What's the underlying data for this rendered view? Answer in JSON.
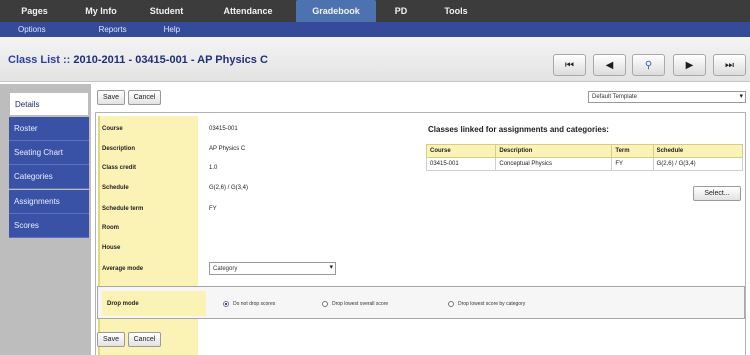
{
  "topnav": {
    "tabs": [
      {
        "label": "Pages"
      },
      {
        "label": "My Info"
      },
      {
        "label": "Student"
      },
      {
        "label": "Attendance"
      },
      {
        "label": "Gradebook",
        "active": true
      },
      {
        "label": "PD"
      },
      {
        "label": "Tools"
      }
    ]
  },
  "subnav": {
    "items": [
      "Options",
      "Reports",
      "Help"
    ]
  },
  "titlebar": {
    "label": "Class List ::",
    "class_title": "2010-2011 - 03415-001 - AP Physics C",
    "nav": {
      "first_icon": "first-page-icon",
      "prev_icon": "previous-icon",
      "search_icon": "search-icon",
      "next_icon": "next-icon",
      "last_icon": "last-page-icon"
    }
  },
  "sidebar": {
    "items": [
      {
        "label": "Details",
        "active": true
      },
      {
        "label": "Roster"
      },
      {
        "label": "Seating Chart"
      },
      {
        "label": "Categories"
      },
      {
        "label": "Assignments"
      },
      {
        "label": "Scores"
      }
    ]
  },
  "toolbar": {
    "save_label": "Save",
    "cancel_label": "Cancel",
    "template_select": "Default Template"
  },
  "details": {
    "fields": [
      {
        "label": "Course",
        "value": "03415-001"
      },
      {
        "label": "Description",
        "value": "AP Physics C"
      },
      {
        "label": "Class credit",
        "value": "1.0"
      },
      {
        "label": "Schedule",
        "value": "G(2,6) / G(3,4)"
      },
      {
        "label": "Schedule term",
        "value": "FY"
      },
      {
        "label": "Room",
        "value": ""
      },
      {
        "label": "House",
        "value": ""
      },
      {
        "label": "Average mode",
        "value": "Category"
      }
    ]
  },
  "classes": {
    "title": "Classes linked for assignments and categories:",
    "headers": [
      "Course",
      "Description",
      "Term",
      "Schedule"
    ],
    "rows": [
      [
        "03415-001",
        "Conceptual Physics",
        "FY",
        "G(2,6) / G(3,4)"
      ]
    ],
    "button_label": "Select..."
  },
  "drop_mode": {
    "label": "Drop mode",
    "options": [
      {
        "label": "Do not drop scores",
        "selected": true
      },
      {
        "label": "Drop lowest overall score",
        "selected": false
      },
      {
        "label": "Drop lowest score by category",
        "selected": false
      }
    ]
  },
  "bottom": {
    "save_label": "Save",
    "cancel_label": "Cancel"
  }
}
